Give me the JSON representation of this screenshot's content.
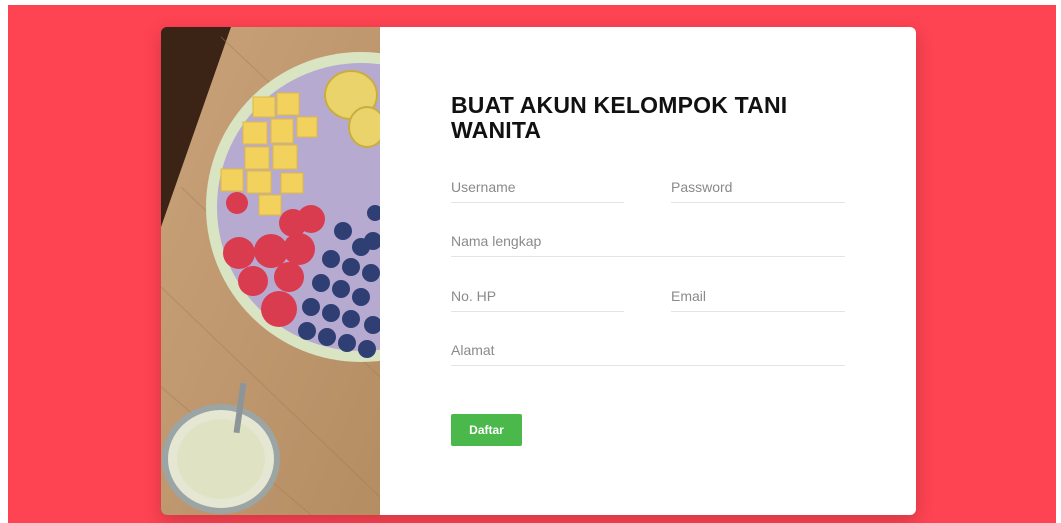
{
  "form": {
    "title": "BUAT AKUN KELOMPOK TANI WANITA",
    "fields": {
      "username_placeholder": "Username",
      "password_placeholder": "Password",
      "nama_placeholder": "Nama lengkap",
      "hp_placeholder": "No. HP",
      "email_placeholder": "Email",
      "alamat_placeholder": "Alamat"
    },
    "submit_label": "Daftar"
  },
  "colors": {
    "background": "#fe4352",
    "button": "#4bb84b"
  }
}
